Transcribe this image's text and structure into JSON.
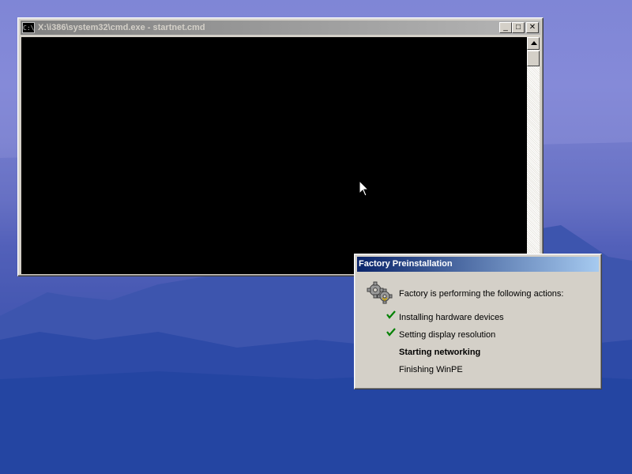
{
  "cmd_window": {
    "title": "X:\\i386\\system32\\cmd.exe - startnet.cmd",
    "icon_text": "C:\\",
    "minimize_glyph": "_",
    "maximize_glyph": "□",
    "close_glyph": "✕"
  },
  "factory_dialog": {
    "title": "Factory Preinstallation",
    "message": "Factory is performing the following actions:",
    "tasks": [
      {
        "label": "Installing hardware devices",
        "status": "done"
      },
      {
        "label": "Setting display resolution",
        "status": "done"
      },
      {
        "label": "Starting networking",
        "status": "current"
      },
      {
        "label": "Finishing WinPE",
        "status": "pending"
      }
    ]
  },
  "icons": {
    "cmd_system": "cmd-icon",
    "gear": "gear-icon",
    "check": "check-icon",
    "cursor": "mouse-pointer-icon"
  },
  "colors": {
    "inactive_titlebar": "#808080",
    "active_titlebar": "#0a246a",
    "check": "#008000"
  }
}
